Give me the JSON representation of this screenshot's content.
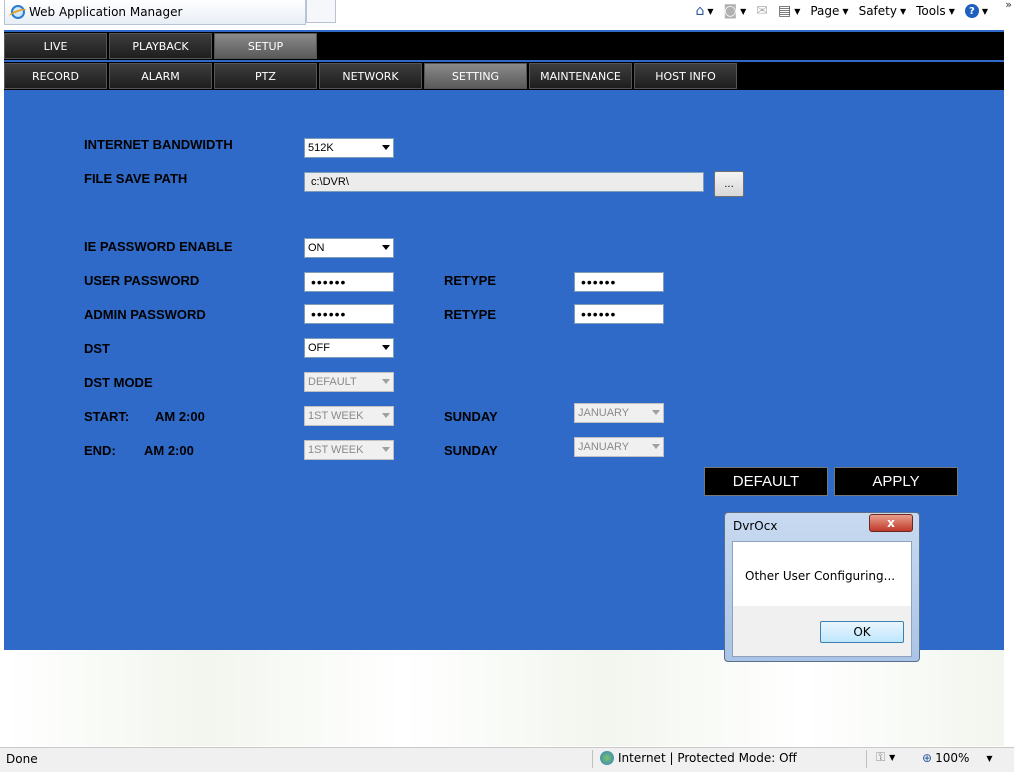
{
  "browser": {
    "tab_title": "Web Application Manager",
    "toolbar": {
      "page": "Page",
      "safety": "Safety",
      "tools": "Tools",
      "help": "?"
    },
    "chevrons": "»"
  },
  "main_menu": [
    "LIVE",
    "PLAYBACK",
    "SETUP"
  ],
  "main_menu_active": "SETUP",
  "sub_menu": [
    "RECORD",
    "ALARM",
    "PTZ",
    "NETWORK",
    "SETTING",
    "MAINTENANCE",
    "HOST INFO"
  ],
  "sub_menu_active": "SETTING",
  "form": {
    "internet_bandwidth": {
      "label": "INTERNET BANDWIDTH",
      "value": "512K"
    },
    "file_save_path": {
      "label": "FILE SAVE PATH",
      "value": "c:\\DVR\\",
      "browse": "..."
    },
    "ie_password_enable": {
      "label": "IE PASSWORD ENABLE",
      "value": "ON"
    },
    "user_password": {
      "label": "USER PASSWORD",
      "value": "••••••",
      "retype_label": "RETYPE",
      "retype_value": "••••••"
    },
    "admin_password": {
      "label": "ADMIN PASSWORD",
      "value": "••••••",
      "retype_label": "RETYPE",
      "retype_value": "••••••"
    },
    "dst": {
      "label": "DST",
      "value": "OFF"
    },
    "dst_mode": {
      "label": "DST MODE",
      "value": "DEFAULT"
    },
    "start": {
      "label": "START:",
      "time": "AM 2:00",
      "week": "1ST WEEK",
      "day": "SUNDAY",
      "month": "JANUARY"
    },
    "end": {
      "label": "END:",
      "time": "AM 2:00",
      "week": "1ST WEEK",
      "day": "SUNDAY",
      "month": "JANUARY"
    }
  },
  "buttons": {
    "default": "DEFAULT",
    "apply": "APPLY"
  },
  "dialog": {
    "title": "DvrOcx",
    "close": "x",
    "message": "Other User Configuring...",
    "ok": "OK"
  },
  "status": {
    "text": "Done",
    "zone": "Internet | Protected Mode: Off",
    "zoom": "100%"
  },
  "colors": {
    "app_bg": "#2f6ac9",
    "menu_bg": "#000000",
    "active_tab": "#6e6e6e"
  }
}
